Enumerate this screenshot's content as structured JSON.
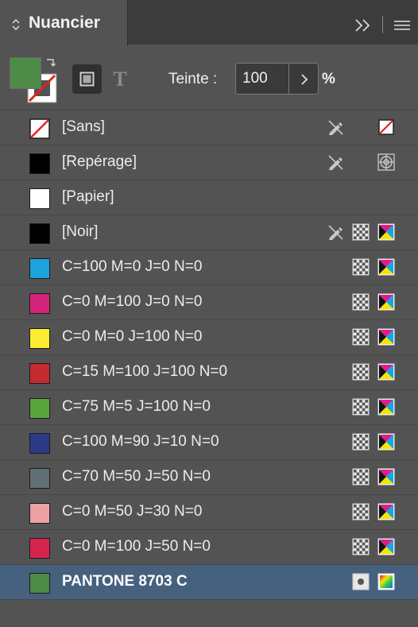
{
  "panel": {
    "title": "Nuancier",
    "fill_color": "#4e8a48",
    "teinte_label": "Teinte :",
    "teinte_value": "100",
    "teinte_unit": "%"
  },
  "swatches": [
    {
      "name": "[Sans]",
      "color": "none",
      "nonedit": true,
      "mode": "none"
    },
    {
      "name": "[Repérage]",
      "color": "#000000",
      "nonedit": true,
      "mode": "registration"
    },
    {
      "name": "[Papier]",
      "color": "#ffffff",
      "nonedit": false,
      "mode": ""
    },
    {
      "name": "[Noir]",
      "color": "#000000",
      "nonedit": true,
      "mode": "cmyk"
    },
    {
      "name": "C=100 M=0 J=0 N=0",
      "color": "#1ca3dd",
      "nonedit": false,
      "mode": "cmyk"
    },
    {
      "name": "C=0 M=100 J=0 N=0",
      "color": "#d4237a",
      "nonedit": false,
      "mode": "cmyk"
    },
    {
      "name": "C=0 M=0 J=100 N=0",
      "color": "#fcec32",
      "nonedit": false,
      "mode": "cmyk"
    },
    {
      "name": "C=15 M=100 J=100 N=0",
      "color": "#c42a2e",
      "nonedit": false,
      "mode": "cmyk"
    },
    {
      "name": "C=75 M=5 J=100 N=0",
      "color": "#5aa43c",
      "nonedit": false,
      "mode": "cmyk"
    },
    {
      "name": "C=100 M=90 J=10 N=0",
      "color": "#2d3a85",
      "nonedit": false,
      "mode": "cmyk"
    },
    {
      "name": "C=70 M=50 J=50 N=0",
      "color": "#607075",
      "nonedit": false,
      "mode": "cmyk"
    },
    {
      "name": "C=0 M=50 J=30 N=0",
      "color": "#eda2a2",
      "nonedit": false,
      "mode": "cmyk"
    },
    {
      "name": "C=0 M=100 J=50 N=0",
      "color": "#d6244f",
      "nonedit": false,
      "mode": "cmyk"
    },
    {
      "name": "PANTONE 8703 C",
      "color": "#4e8a48",
      "nonedit": false,
      "mode": "spot",
      "selected": true
    }
  ]
}
